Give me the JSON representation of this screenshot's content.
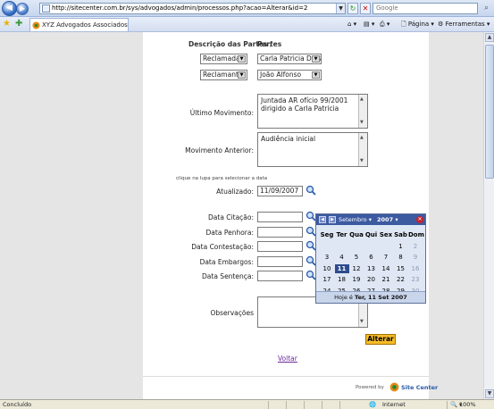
{
  "browser": {
    "url": "http://sitecenter.com.br/sys/advogados/admin/processos.php?acao=Alterar&id=2",
    "search_placeholder": "Google",
    "tab_title": "XYZ Advogados Associados",
    "commands": {
      "page": "Página",
      "tools": "Ferramentas"
    }
  },
  "form": {
    "parties_header_desc": "Descrição das Partes /",
    "parties_header_name": "Partes",
    "parties": [
      {
        "role": "Reclamada",
        "name": "Carla Patricia Dias"
      },
      {
        "role": "Reclamante",
        "name": "João Alfonso"
      }
    ],
    "last_movement_label": "Último Movimento:",
    "last_movement_value": "Juntada AR ofício 99/2001 dirigido a Carla Patricia",
    "previous_movement_label": "Movimento Anterior:",
    "previous_movement_value": "Audiência inicial",
    "date_hint": "clique na lupa para selecionar a data",
    "updated_label": "Atualizado:",
    "updated_value": "11/09/2007",
    "date_fields": [
      {
        "label": "Data Citação:",
        "value": ""
      },
      {
        "label": "Data Penhora:",
        "value": ""
      },
      {
        "label": "Data Contestação:",
        "value": ""
      },
      {
        "label": "Data Embargos:",
        "value": ""
      },
      {
        "label": "Data Sentença:",
        "value": ""
      }
    ],
    "observations_label": "Observações",
    "observations_value": "",
    "submit_label": "Alterar",
    "back_link": "Voltar",
    "powered_by": "Powered by",
    "brand": "Site Center"
  },
  "calendar": {
    "month": "Setembro",
    "year": "2007",
    "weekdays": [
      "Seg",
      "Ter",
      "Qua",
      "Qui",
      "Sex",
      "Sab",
      "Dom"
    ],
    "weeks": [
      [
        {
          "d": "",
          "o": false
        },
        {
          "d": "",
          "o": false
        },
        {
          "d": "",
          "o": false
        },
        {
          "d": "",
          "o": false
        },
        {
          "d": "",
          "o": false
        },
        {
          "d": "1",
          "o": false
        },
        {
          "d": "2",
          "o": true
        }
      ],
      [
        {
          "d": "3",
          "o": false
        },
        {
          "d": "4",
          "o": false
        },
        {
          "d": "5",
          "o": false
        },
        {
          "d": "6",
          "o": false
        },
        {
          "d": "7",
          "o": false
        },
        {
          "d": "8",
          "o": false
        },
        {
          "d": "9",
          "o": true
        }
      ],
      [
        {
          "d": "10",
          "o": false
        },
        {
          "d": "11",
          "o": false,
          "sel": true
        },
        {
          "d": "12",
          "o": false
        },
        {
          "d": "13",
          "o": false
        },
        {
          "d": "14",
          "o": false
        },
        {
          "d": "15",
          "o": false
        },
        {
          "d": "16",
          "o": true
        }
      ],
      [
        {
          "d": "17",
          "o": false
        },
        {
          "d": "18",
          "o": false
        },
        {
          "d": "19",
          "o": false
        },
        {
          "d": "20",
          "o": false
        },
        {
          "d": "21",
          "o": false
        },
        {
          "d": "22",
          "o": false
        },
        {
          "d": "23",
          "o": true
        }
      ],
      [
        {
          "d": "24",
          "o": false
        },
        {
          "d": "25",
          "o": false
        },
        {
          "d": "26",
          "o": false
        },
        {
          "d": "27",
          "o": false
        },
        {
          "d": "28",
          "o": false
        },
        {
          "d": "29",
          "o": false
        },
        {
          "d": "30",
          "o": true
        }
      ]
    ],
    "today_prefix": "Hoje é",
    "today_value": "Ter, 11 Set 2007"
  },
  "status": {
    "left": "Concluído",
    "zone": "Internet",
    "zoom": "100%"
  },
  "colors": {
    "accent": "#3c5aa0",
    "button": "#f6bd2a",
    "link": "#6a2a9a"
  }
}
